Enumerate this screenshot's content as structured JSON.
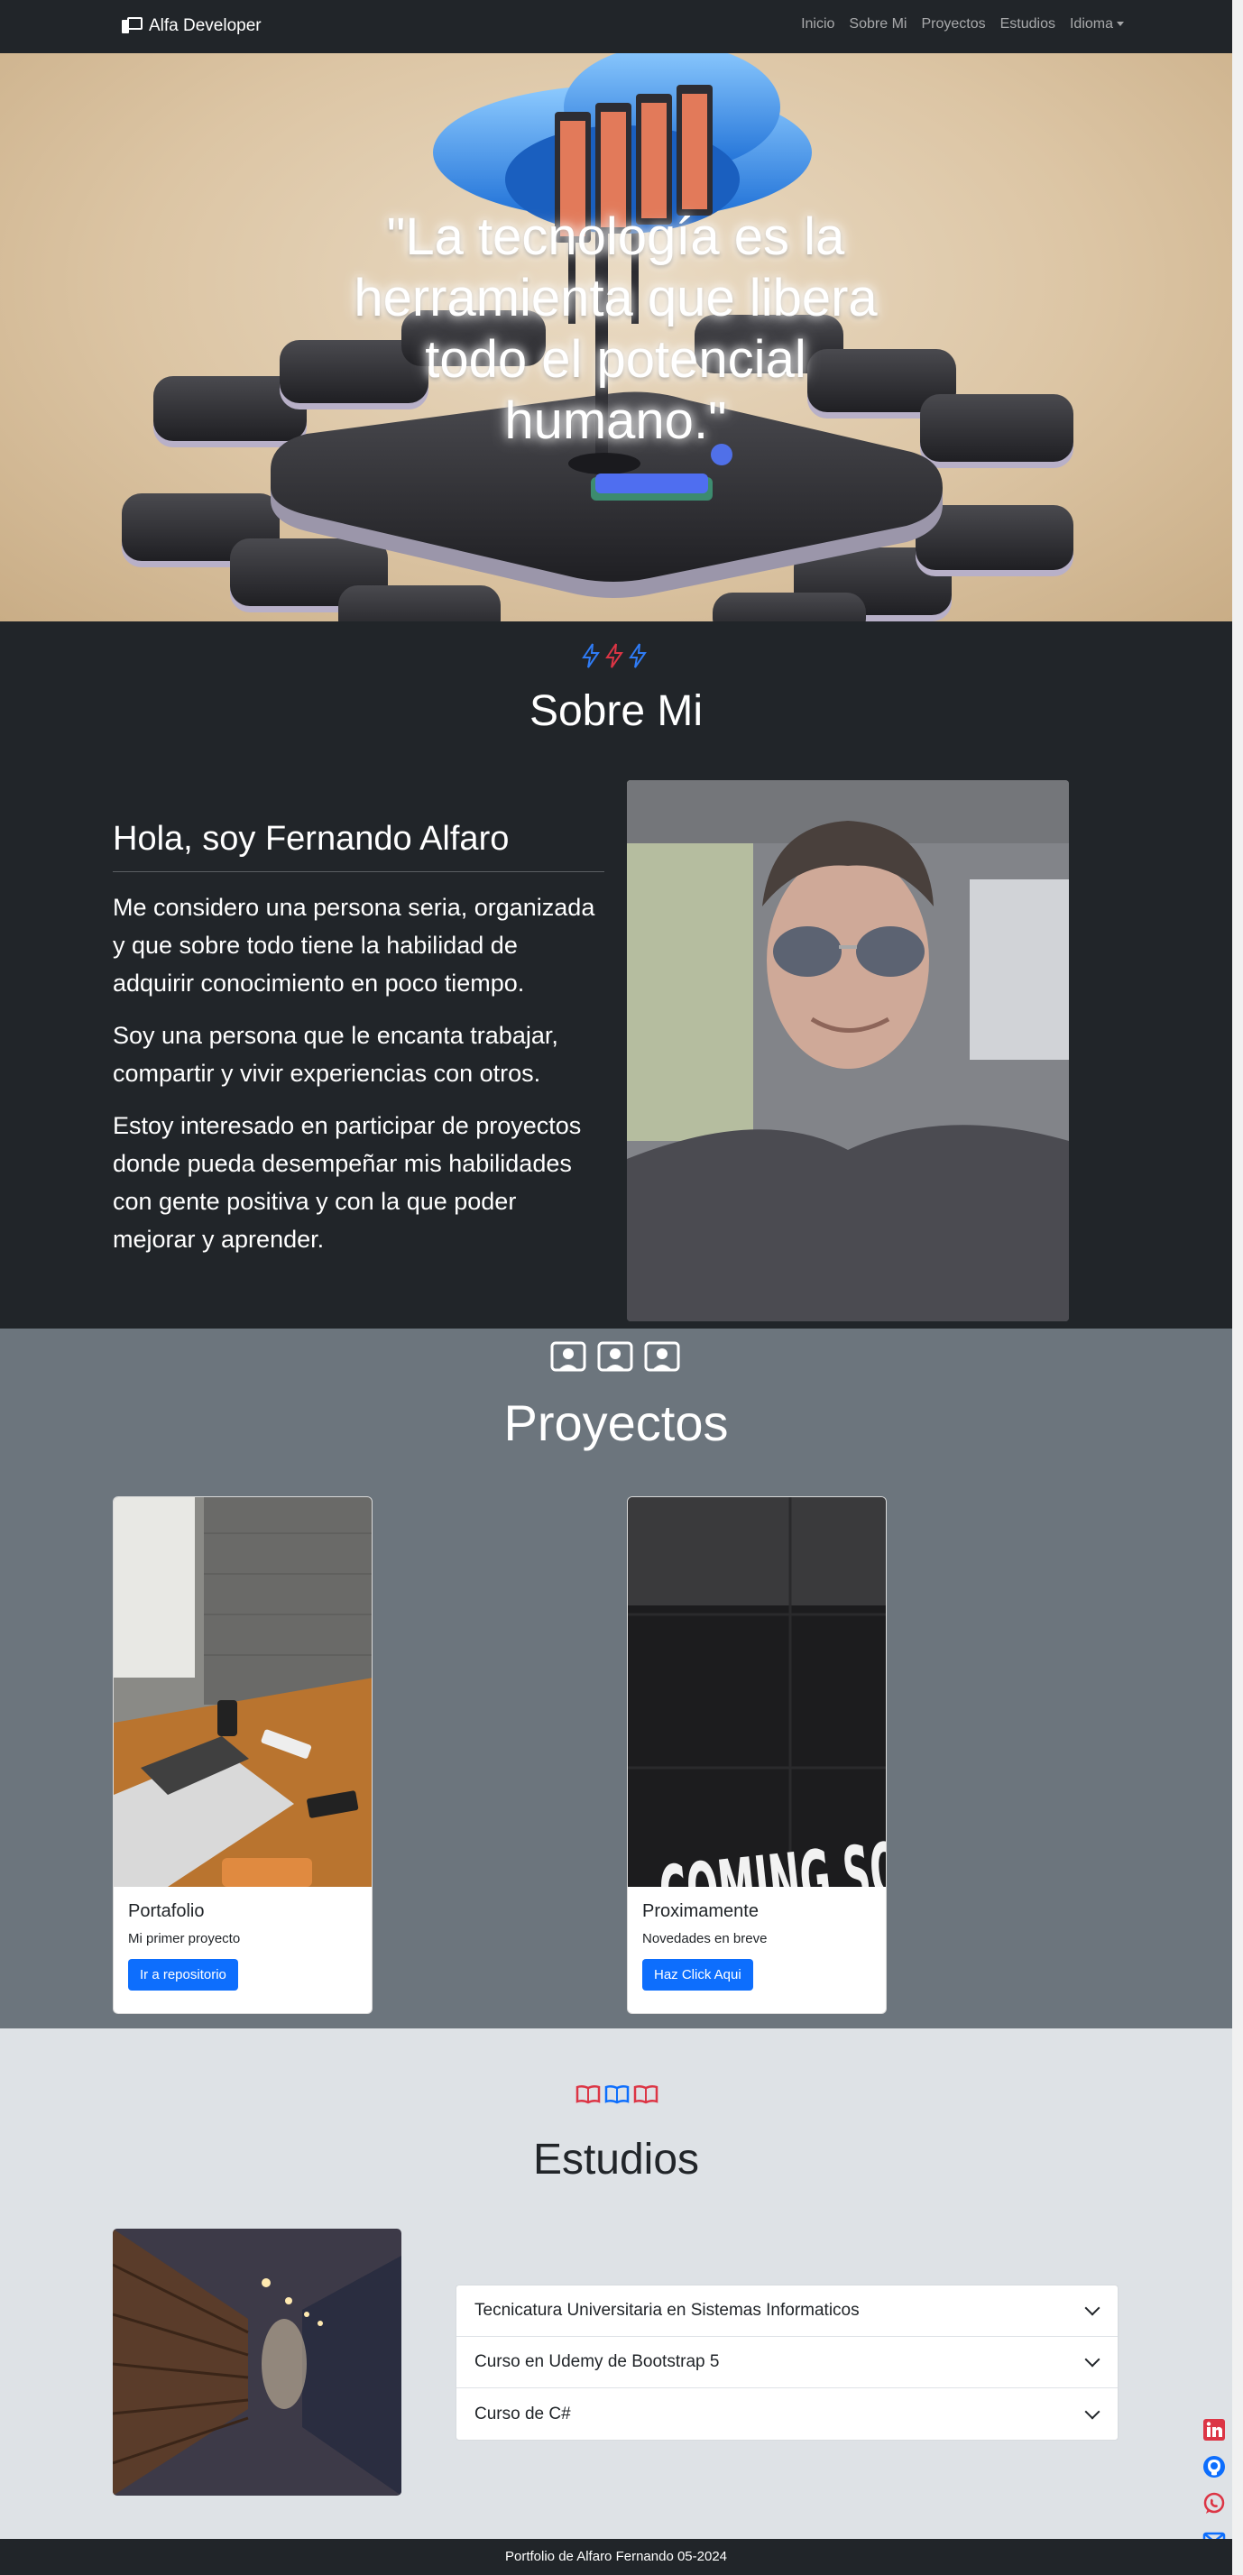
{
  "navbar": {
    "brand": "Alfa Developer",
    "links": [
      "Inicio",
      "Sobre Mi",
      "Proyectos",
      "Estudios"
    ],
    "dropdown": "Idioma"
  },
  "hero": {
    "quote": "\"La tecnología es la herramienta que libera todo el potencial humano.\""
  },
  "about": {
    "title": "Sobre Mi",
    "heading": "Hola, soy Fernando Alfaro",
    "paragraphs": [
      "Me considero una persona seria, organizada y que sobre todo tiene la habilidad de adquirir conocimiento en poco tiempo.",
      "Soy una persona que le encanta trabajar, compartir y vivir experiencias con otros.",
      "Estoy interesado en participar de proyectos donde pueda desempeñar mis habilidades con gente positiva y con la que poder mejorar y aprender."
    ]
  },
  "projects": {
    "title": "Proyectos",
    "cards": [
      {
        "title": "Portafolio",
        "text": "Mi primer proyecto",
        "button": "Ir a repositorio"
      },
      {
        "title": "Proximamente",
        "text": "Novedades en breve",
        "button": "Haz Click Aqui",
        "image_text": "COMING SOON"
      }
    ]
  },
  "studies": {
    "title": "Estudios",
    "items": [
      "Tecnicatura Universitaria en Sistemas Informaticos",
      "Curso en Udemy de Bootstrap 5",
      "Curso de C#"
    ]
  },
  "footer": {
    "text": "Portfolio de Alfaro Fernando 05-2024"
  },
  "social": [
    "linkedin-icon",
    "github-icon",
    "whatsapp-icon",
    "email-icon"
  ],
  "colors": {
    "navbar": "#212529",
    "about_bg": "#212529",
    "projects_bg": "#6c757d",
    "studies_bg": "#dee2e6",
    "button": "#0d6efd"
  }
}
